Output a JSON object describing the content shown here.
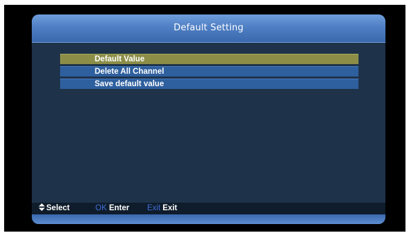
{
  "window": {
    "title": "Default Setting"
  },
  "menu": {
    "items": [
      {
        "label": "Default Value",
        "selected": true
      },
      {
        "label": "Delete All Channel",
        "selected": false
      },
      {
        "label": "Save default value",
        "selected": false
      }
    ]
  },
  "footer": {
    "select": {
      "icon": "up-down-arrow-icon",
      "label": "Select"
    },
    "enter": {
      "key": "OK",
      "label": "Enter"
    },
    "exit": {
      "key": "Exit",
      "label": "Exit"
    }
  },
  "colors": {
    "selected_item": "#8c8e48",
    "item": "#2e5f9e",
    "panel": "#1e3249",
    "header": "#4f7fc4",
    "key_hint": "#3f6fd8"
  }
}
